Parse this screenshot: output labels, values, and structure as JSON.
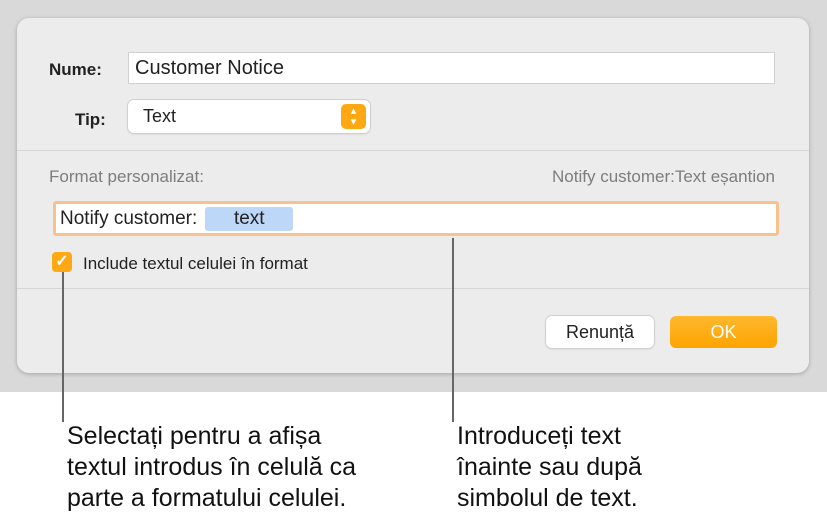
{
  "dialog": {
    "name_label": "Nume:",
    "name_value": "Customer Notice",
    "type_label": "Tip:",
    "type_value": "Text",
    "custom_format_label": "Format personalizat:",
    "sample": "Notify customer:Text eșantion",
    "format_prefix": "Notify customer:",
    "format_token": "text",
    "include_checkbox": {
      "label": "Include textul celulei în format",
      "checked": true
    },
    "cancel_label": "Renunță",
    "ok_label": "OK",
    "accent": "#fea914"
  },
  "callouts": {
    "left": [
      "Selectați pentru a afișa",
      "textul introdus în celulă ca",
      "parte a formatului celulei."
    ],
    "right": [
      "Introduceți text",
      "înainte sau după",
      "simbolul de text."
    ]
  }
}
